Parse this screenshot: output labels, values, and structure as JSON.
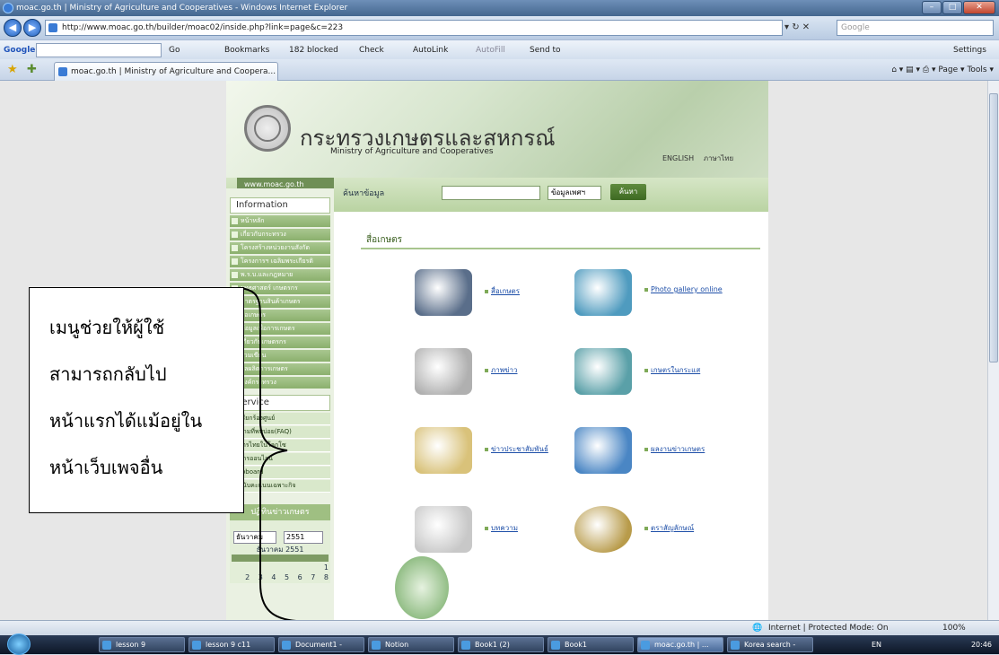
{
  "window": {
    "title": "moac.go.th | Ministry of Agriculture and Cooperatives - Windows Internet Explorer"
  },
  "address": {
    "url": "http://www.moac.go.th/builder/moac02/inside.php?link=page&c=223",
    "search_placeholder": "Google"
  },
  "googlebar": {
    "label": "Google",
    "go": "Go",
    "bookmarks": "Bookmarks",
    "blocked": "182 blocked",
    "check": "Check",
    "autolink": "AutoLink",
    "autofill": "AutoFill",
    "sendto": "Send to",
    "settings": "Settings"
  },
  "tabbar": {
    "tab_title": "moac.go.th | Ministry of Agriculture and Coopera...",
    "page": "Page",
    "tools": "Tools"
  },
  "site": {
    "title_th": "กระทรวงเกษตรและสหกรณ์",
    "title_en": "Ministry of Agriculture and Cooperatives",
    "lang_en": "ENGLISH",
    "lang_th": "ภาษาไทย",
    "sitename": "www.moac.go.th",
    "search_label": "ค้นหาข้อมูล",
    "search_select": "ข้อมูลเพศฯ",
    "search_button": "ค้นหา"
  },
  "sidebar": {
    "info_title": "Information",
    "info_items": [
      "หน้าหลัก",
      "เกี่ยวกับกระทรวง",
      "โครงสร้างหน่วยงานสังกัด",
      "โครงการฯ เฉลิมพระเกียรติ",
      "พ.ร.บ.และกฎหมาย",
      "ยุทธศาสตร์ เกษตรกร",
      "มาตรฐานสินค้าเกษตร",
      "สื่อเกษตร",
      "ข้อมูลเพื่อการเกษตร",
      "เกี่ยวกับเกษตรกร",
      "ร่วมเขียน",
      "ผลผลิตการเกษตร",
      "ลิงค์กระทรวง"
    ],
    "service_title": "Service",
    "service_items": [
      "ข้อเรียกร้องศูนย์",
      "คำถามที่พบบ่อย(FAQ)",
      "เกษตรไทยในโลกโซ",
      "บริการออนไลน์",
      "Webboard",
      "การนับคะแนนเฉพาะกิจ"
    ],
    "calendar_title": "ปฏิทินข่าวเกษตร",
    "cal_month_select": "ธันวาคม",
    "cal_year_select": "2551",
    "cal_month_label": "ธันวาคม 2551",
    "cal_row1": "1",
    "cal_row2": "2 3 4 5 6 7 8"
  },
  "content": {
    "section_title": "สื่อเกษตร",
    "tiles": [
      {
        "icon": "computer-icon",
        "label": "สื่อเกษตร"
      },
      {
        "icon": "photo-search-icon",
        "label": "Photo gallery online"
      },
      {
        "icon": "book-icon",
        "label": "ภาพข่าว"
      },
      {
        "icon": "globe-search-icon",
        "label": "เกษตรในกระแส"
      },
      {
        "icon": "news-icon",
        "label": "ข่าวประชาสัมพันธ์"
      },
      {
        "icon": "mail-icon",
        "label": "ผลงานข่าวเกษตร"
      },
      {
        "icon": "pen-icon",
        "label": "บทความ"
      },
      {
        "icon": "seal-icon",
        "label": "ตราสัญลักษณ์"
      }
    ]
  },
  "callout": {
    "line1": "เมนูช่วยให้ผู้ใช้",
    "line2": "สามารถกลับไป",
    "line3": "หน้าแรกได้แม้อยู่ใน",
    "line4": "หน้าเว็บเพจอื่น"
  },
  "statusbar": {
    "zone": "Internet | Protected Mode: On",
    "zoom": "100%"
  },
  "taskbar": {
    "buttons": [
      "lesson 9",
      "lesson 9 c11",
      "Document1 -",
      "Notion",
      "Book1 (2)",
      "Book1",
      "moac.go.th | ...",
      "Korea search -"
    ],
    "lang": "EN",
    "time": "20:46"
  }
}
